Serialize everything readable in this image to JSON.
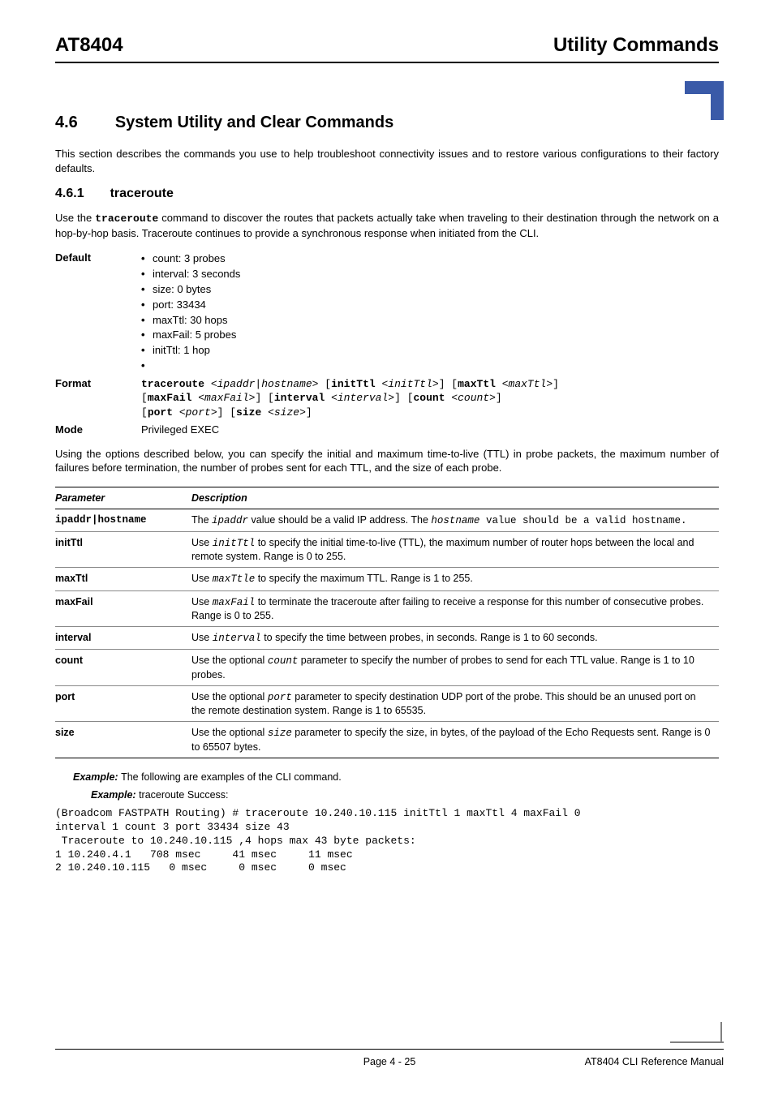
{
  "header": {
    "left": "AT8404",
    "right": "Utility Commands"
  },
  "section": {
    "num": "4.6",
    "title": "System Utility and Clear Commands",
    "intro": "This section describes the commands you use to help troubleshoot connectivity issues and to restore various configurations to their factory defaults."
  },
  "subsection": {
    "num": "4.6.1",
    "title": "traceroute",
    "intro_pre": "Use the ",
    "intro_cmd": "traceroute",
    "intro_post": " command to discover the routes that packets actually take when traveling to their destination through the network on a hop-by-hop basis. Traceroute continues to provide a synchronous response when initiated from the CLI."
  },
  "defaults_label": "Default",
  "defaults": [
    "count: 3 probes",
    "interval: 3 seconds",
    "size: 0 bytes",
    "port: 33434",
    "maxTtl: 30 hops",
    "maxFail: 5 probes",
    "initTtl: 1 hop",
    ""
  ],
  "format_label": "Format",
  "format": {
    "kw_traceroute": "traceroute ",
    "arg_ipaddr": "<ipaddr|hostname>",
    "sp1": " [",
    "kw_initTtl": "initTtl ",
    "arg_initTtl": "<initTtl>",
    "sp2": "] [",
    "kw_maxTtl": "maxTtl ",
    "arg_maxTtl": "<maxTtl>",
    "sp3": "] ",
    "line2_open": "[",
    "kw_maxFail": "maxFail ",
    "arg_maxFail": "<maxFail>",
    "sp4": "] [",
    "kw_interval": "interval ",
    "arg_interval": "<interval>",
    "sp5": "] [",
    "kw_count": "count ",
    "arg_count": "<count>",
    "sp6": "] ",
    "line3_open": "[",
    "kw_port": "port ",
    "arg_port": "<port>",
    "sp7": "] [",
    "kw_size": "size ",
    "arg_size": "<size>",
    "sp8": "]"
  },
  "mode_label": "Mode",
  "mode_value": "Privileged EXEC",
  "options_intro": "Using the options described below, you can specify the initial and maximum time-to-live (TTL) in probe packets, the maximum number of failures before termination, the number of probes sent for each TTL, and the size of each probe.",
  "table": {
    "h1": "Parameter",
    "h2": "Description",
    "rows": [
      {
        "param": "ipaddr|hostname",
        "param_mono": true,
        "desc_pre": "The ",
        "desc_code1": "ipaddr",
        "desc_mid": " value should be a valid IP address. The ",
        "desc_code2": "hostname",
        "desc_post": " value should be a valid hostname.",
        "post_mono": true
      },
      {
        "param": "initTtl",
        "desc_pre": "Use ",
        "desc_code1": "initTtl",
        "desc_post": " to specify the initial time-to-live (TTL), the maximum number of router hops between the local and remote system. Range is 0 to 255."
      },
      {
        "param": "maxTtl",
        "desc_pre": "Use ",
        "desc_code1": "maxTtle",
        "desc_post": " to specify the maximum TTL. Range is 1 to 255."
      },
      {
        "param": "maxFail",
        "desc_pre": "Use ",
        "desc_code1": "maxFail",
        "desc_post": " to terminate the traceroute after failing to receive a response for this number of consecutive probes. Range is 0 to 255."
      },
      {
        "param": "interval",
        "desc_pre": "Use ",
        "desc_code1": "interval",
        "desc_post": " to specify the time between probes, in seconds. Range is 1 to 60 seconds."
      },
      {
        "param": "count",
        "desc_pre": "Use the optional ",
        "desc_code1": "count",
        "desc_post": " parameter to specify the number of probes to send for each TTL value. Range is 1 to 10 probes."
      },
      {
        "param": "port",
        "desc_pre": "Use the optional ",
        "desc_code1": "port",
        "desc_post": " parameter to specify destination UDP port of the probe. This should be an unused port on the remote destination system. Range is 1 to 65535."
      },
      {
        "param": "size",
        "desc_pre": "Use the optional ",
        "desc_code1": "size",
        "desc_post": " parameter to specify the size, in bytes, of the payload of the Echo Requests sent. Range is 0 to 65507 bytes."
      }
    ]
  },
  "example1_label": "Example: ",
  "example1_text": "The following are examples of the CLI command.",
  "example2_label": "Example: ",
  "example2_text": "traceroute Success:",
  "code": "(Broadcom FASTPATH Routing) # traceroute 10.240.10.115 initTtl 1 maxTtl 4 maxFail 0\ninterval 1 count 3 port 33434 size 43\n Traceroute to 10.240.10.115 ,4 hops max 43 byte packets:\n1 10.240.4.1   708 msec     41 msec     11 msec\n2 10.240.10.115   0 msec     0 msec     0 msec",
  "footer": {
    "center": "Page 4 - 25",
    "right": "AT8404 CLI Reference Manual"
  }
}
